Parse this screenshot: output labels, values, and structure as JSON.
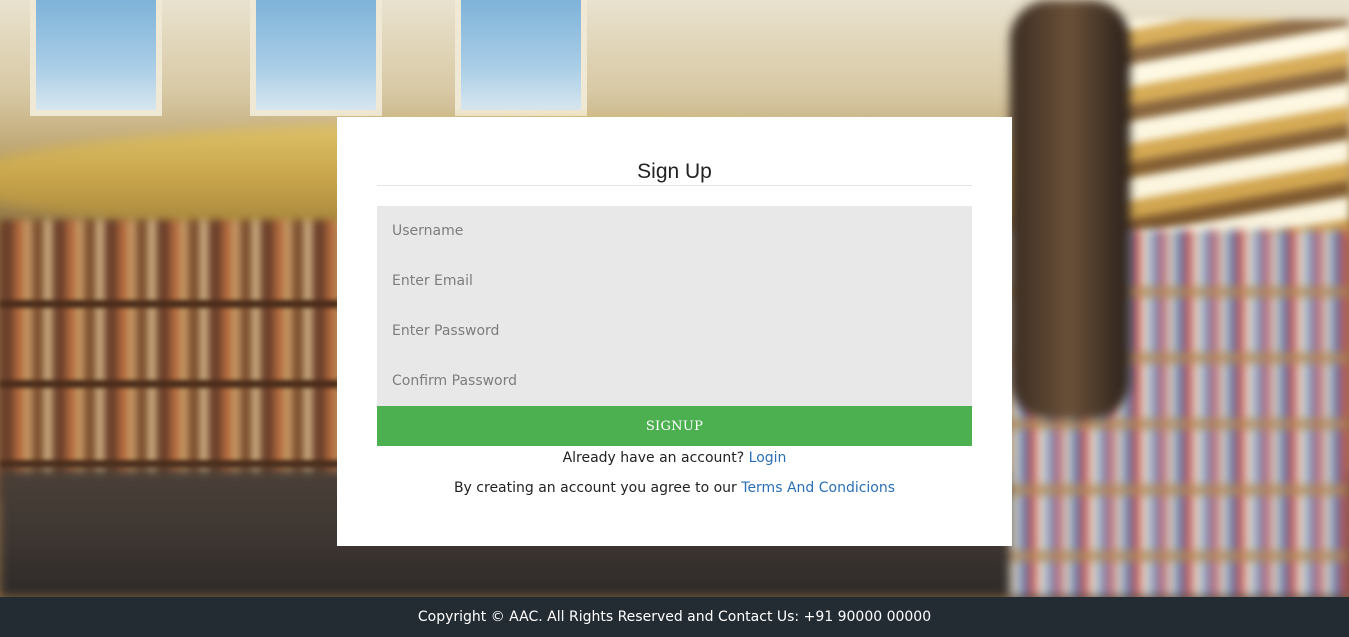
{
  "signup_card": {
    "title": "Sign Up",
    "fields": {
      "username_placeholder": "Username",
      "email_placeholder": "Enter Email",
      "password_placeholder": "Enter Password",
      "confirm_password_placeholder": "Confirm Password"
    },
    "submit_label": "SIGNUP",
    "login_prompt": "Already have an account?",
    "login_link": "Login",
    "terms_prompt": "By creating an account you agree to our",
    "terms_link": "Terms And Condicions"
  },
  "footer": {
    "text": "Copyright © AAC. All Rights Reserved and Contact Us: +91 90000 00000"
  },
  "colors": {
    "submit_button": "#4caf50",
    "link": "#2a6fb5",
    "footer_bg": "#232c33",
    "input_bg": "#e8e8e8"
  },
  "icons": {
    "background": "library-background-image"
  }
}
